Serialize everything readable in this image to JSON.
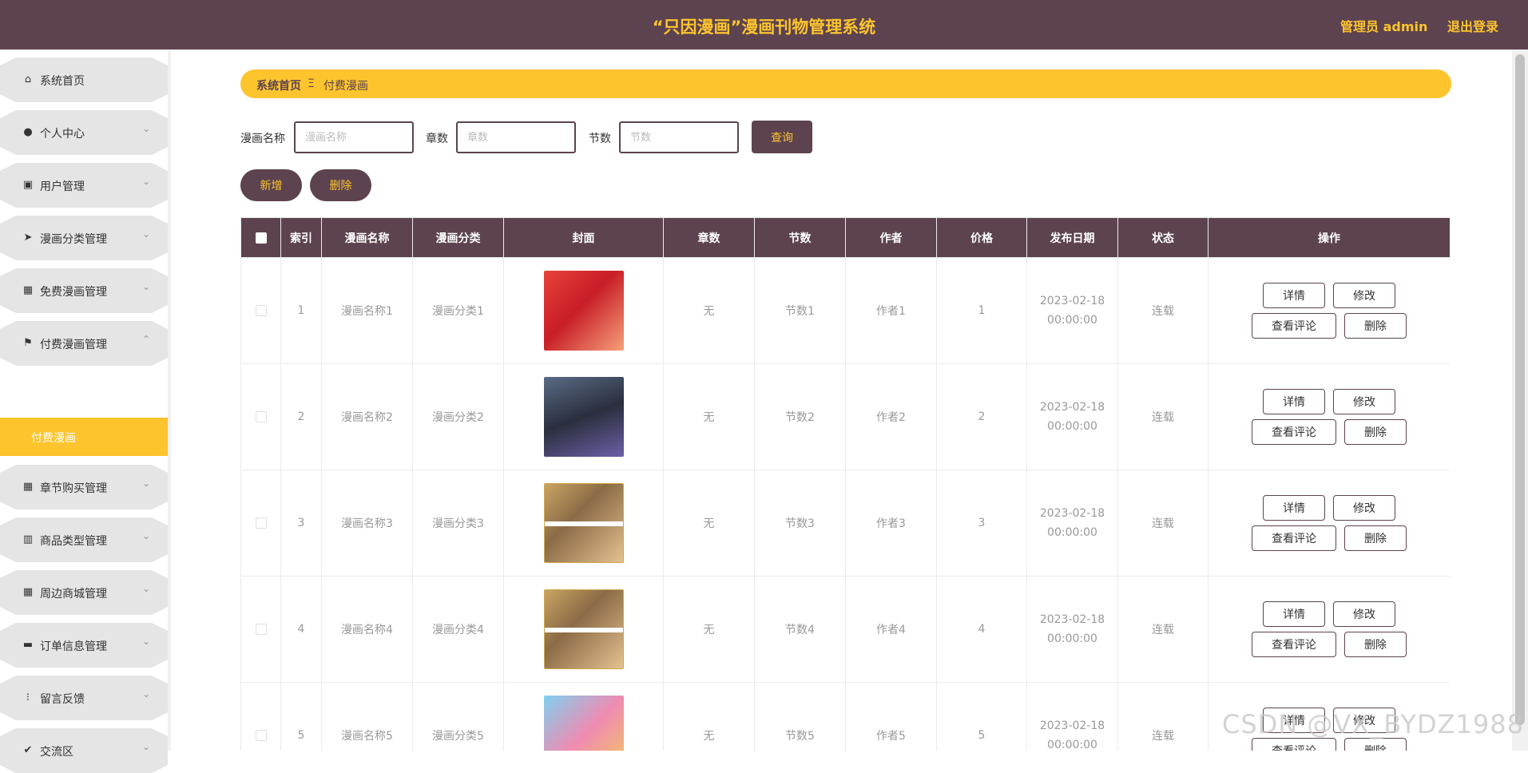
{
  "header": {
    "title": "“只因漫画”漫画刊物管理系统",
    "admin_label": "管理员 admin",
    "logout_label": "退出登录"
  },
  "sidebar": {
    "items": [
      {
        "label": "系统首页",
        "icon": "home-icon"
      },
      {
        "label": "个人中心",
        "icon": "user-icon"
      },
      {
        "label": "用户管理",
        "icon": "delete-file-icon"
      },
      {
        "label": "漫画分类管理",
        "icon": "send-icon"
      },
      {
        "label": "免费漫画管理",
        "icon": "grid-icon"
      },
      {
        "label": "付费漫画管理",
        "icon": "flag-icon"
      },
      {
        "label": "章节购买管理",
        "icon": "grid-icon"
      },
      {
        "label": "商品类型管理",
        "icon": "bars-icon"
      },
      {
        "label": "周边商城管理",
        "icon": "grid-icon"
      },
      {
        "label": "订单信息管理",
        "icon": "message-icon"
      },
      {
        "label": "留言反馈",
        "icon": "dots-grid-icon"
      },
      {
        "label": "交流区",
        "icon": "clipboard-check-icon"
      }
    ],
    "active_sub": "付费漫画"
  },
  "breadcrumb": {
    "home": "系统首页",
    "separator": "Ξ",
    "current": "付费漫画"
  },
  "search": {
    "name_label": "漫画名称",
    "name_placeholder": "漫画名称",
    "chapter_label": "章数",
    "chapter_placeholder": "章数",
    "section_label": "节数",
    "section_placeholder": "节数",
    "query_label": "查询"
  },
  "actions": {
    "add_label": "新增",
    "delete_label": "删除"
  },
  "table": {
    "columns": [
      "索引",
      "漫画名称",
      "漫画分类",
      "封面",
      "章数",
      "节数",
      "作者",
      "价格",
      "发布日期",
      "状态",
      "操作"
    ],
    "rows": [
      {
        "index": "1",
        "name": "漫画名称1",
        "category": "漫画分类1",
        "chapter": "无",
        "section": "节数1",
        "author": "作者1",
        "price": "1",
        "date": "2023-02-18 00:00:00",
        "status": "连载"
      },
      {
        "index": "2",
        "name": "漫画名称2",
        "category": "漫画分类2",
        "chapter": "无",
        "section": "节数2",
        "author": "作者2",
        "price": "2",
        "date": "2023-02-18 00:00:00",
        "status": "连载"
      },
      {
        "index": "3",
        "name": "漫画名称3",
        "category": "漫画分类3",
        "chapter": "无",
        "section": "节数3",
        "author": "作者3",
        "price": "3",
        "date": "2023-02-18 00:00:00",
        "status": "连载"
      },
      {
        "index": "4",
        "name": "漫画名称4",
        "category": "漫画分类4",
        "chapter": "无",
        "section": "节数4",
        "author": "作者4",
        "price": "4",
        "date": "2023-02-18 00:00:00",
        "status": "连载"
      },
      {
        "index": "5",
        "name": "漫画名称5",
        "category": "漫画分类5",
        "chapter": "无",
        "section": "节数5",
        "author": "作者5",
        "price": "5",
        "date": "2023-02-18 00:00:00",
        "status": "连载"
      }
    ],
    "ops": {
      "detail": "详情",
      "edit": "修改",
      "comments": "查看评论",
      "delete": "删除"
    }
  },
  "watermark": "CSDN @VX_BYDZ1988",
  "colors": {
    "primary": "#5c434f",
    "accent": "#fdc42e"
  }
}
